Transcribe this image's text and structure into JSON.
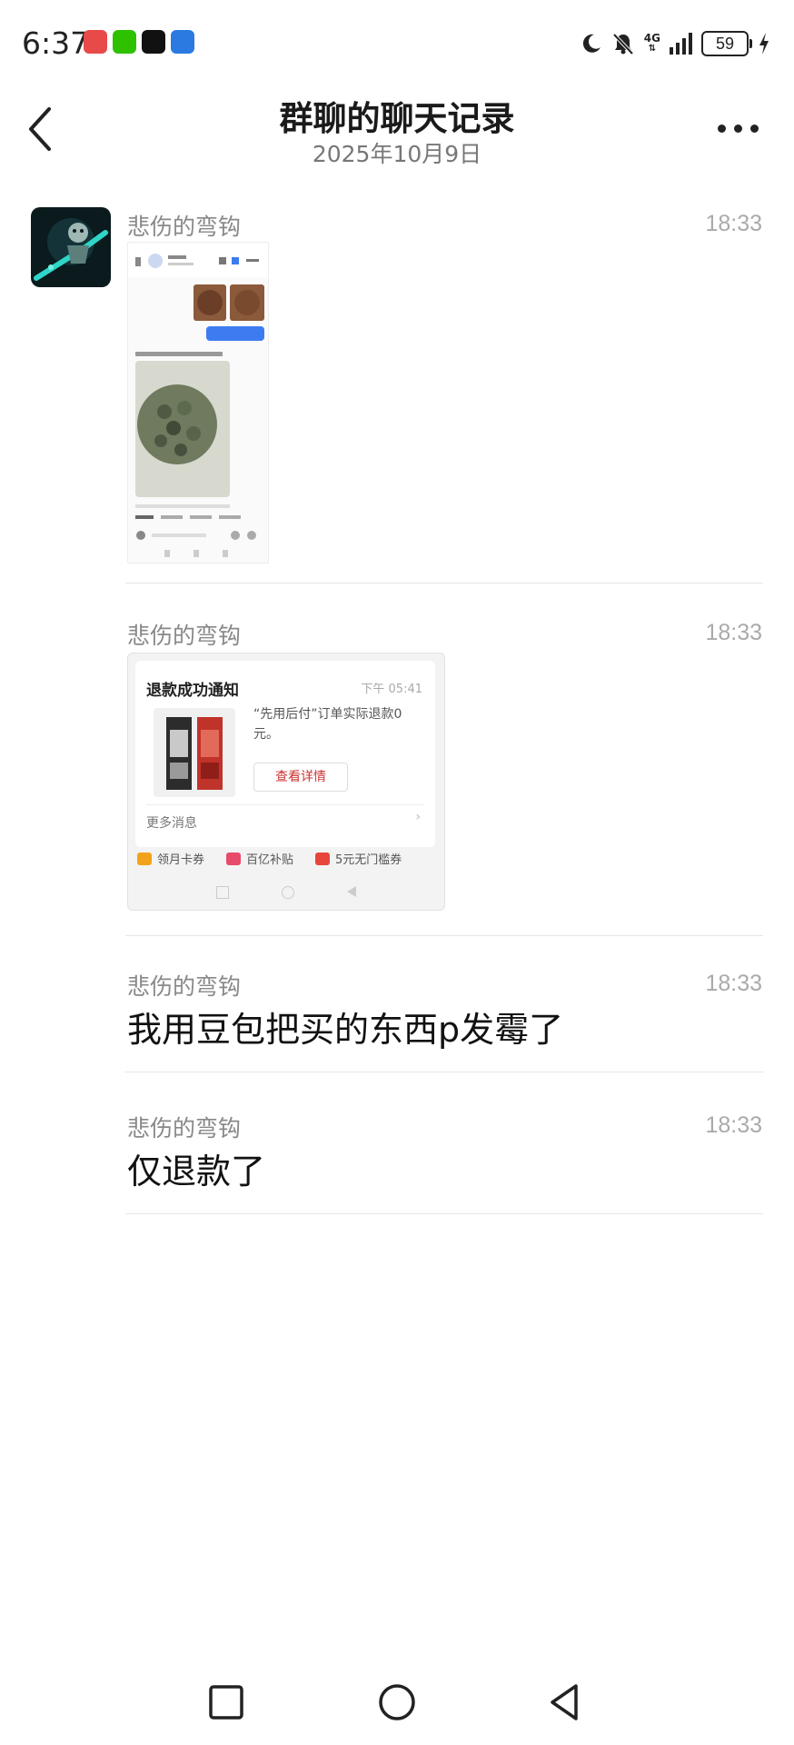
{
  "status_bar": {
    "time": "6:37",
    "battery": "59",
    "network": "4G",
    "app_badges": [
      {
        "name": "app-badge-red",
        "color": "#e84a4a"
      },
      {
        "name": "wechat-icon",
        "color": "#2dc100"
      },
      {
        "name": "tiktok-icon",
        "color": "#111111"
      },
      {
        "name": "qq-icon",
        "color": "#2a7ae2"
      }
    ]
  },
  "header": {
    "title": "群聊的聊天记录",
    "date": "2025年10月9日"
  },
  "messages": [
    {
      "sender": "悲伤的弯钩",
      "time": "18:33",
      "type": "image"
    },
    {
      "sender": "悲伤的弯钩",
      "time": "18:33",
      "type": "image",
      "card": {
        "title": "退款成功通知",
        "time": "下午 05:41",
        "desc": "“先用后付”订单实际退款0元。",
        "button": "查看详情",
        "more": "更多消息",
        "links": [
          "领月卡券",
          "百亿补贴",
          "5元无门槛券"
        ]
      }
    },
    {
      "sender": "悲伤的弯钩",
      "time": "18:33",
      "type": "text",
      "text": "我用豆包把买的东西p发霉了"
    },
    {
      "sender": "悲伤的弯钩",
      "time": "18:33",
      "type": "text",
      "text": "仅退款了"
    }
  ],
  "colors": {
    "accent_blue": "#3d7cf0",
    "timestamp_gray": "#aaaaaa",
    "name_gray": "#888888"
  }
}
